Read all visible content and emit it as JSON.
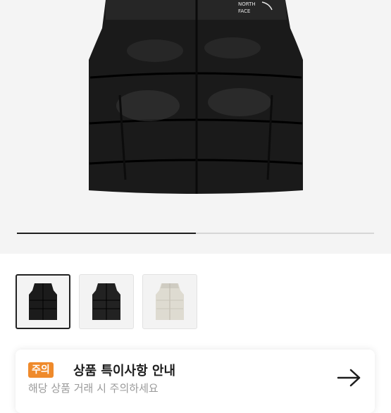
{
  "product_image": {
    "brand_mark": "THE NORTH FACE",
    "image_count": 3,
    "current_image": 1
  },
  "gallery_progress": 0.5,
  "thumbnails": [
    {
      "label": "black-vest",
      "color": "#1b1b1b",
      "selected": true
    },
    {
      "label": "black-vest-alt",
      "color": "#222222",
      "selected": false
    },
    {
      "label": "beige-vest",
      "color": "#dedbd1",
      "selected": false
    }
  ],
  "notice": {
    "badge": "주의",
    "title": "상품 특이사항 안내",
    "subtitle": "해당 상품 거래 시 주의하세요",
    "accent_color": "#ef8a2b"
  }
}
